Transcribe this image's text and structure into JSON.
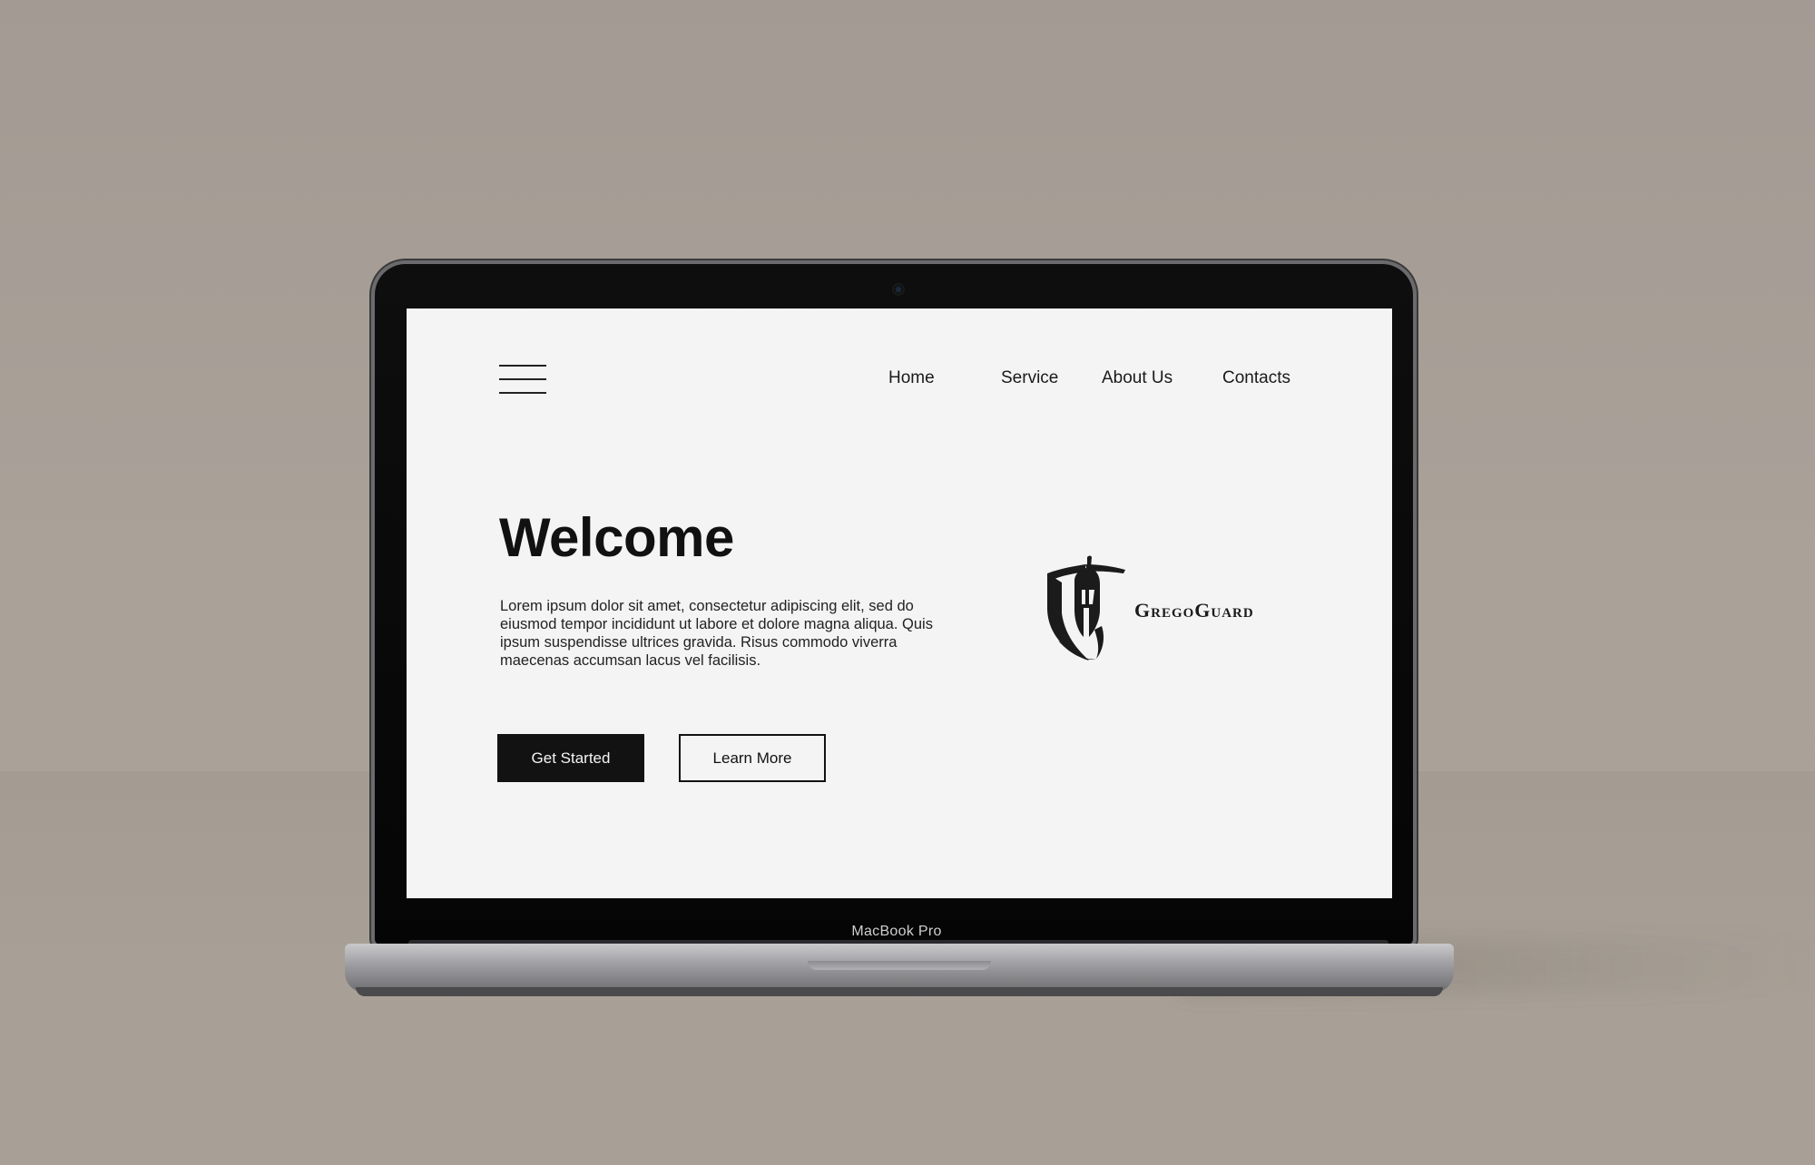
{
  "device": {
    "model_label": "MacBook Pro"
  },
  "menu": {
    "icon": "hamburger-menu-icon"
  },
  "nav": {
    "items": [
      {
        "label": "Home"
      },
      {
        "label": "Service"
      },
      {
        "label": "About Us"
      },
      {
        "label": "Contacts"
      }
    ]
  },
  "hero": {
    "title": "Welcome",
    "body": "Lorem ipsum dolor sit amet, consectetur adipiscing elit, sed do eiusmod tempor incididunt ut labore et dolore magna aliqua. Quis ipsum suspendisse ultrices gravida. Risus commodo viverra maecenas accumsan lacus vel facilisis.",
    "primary_button": "Get Started",
    "secondary_button": "Learn More"
  },
  "logo": {
    "icon": "spartan-helmet-shield-icon",
    "name": "GregoGuard"
  },
  "colors": {
    "screen_background": "#f4f4f4",
    "text": "#111111",
    "primary_button_bg": "#121212",
    "wall": "#a8a096"
  }
}
